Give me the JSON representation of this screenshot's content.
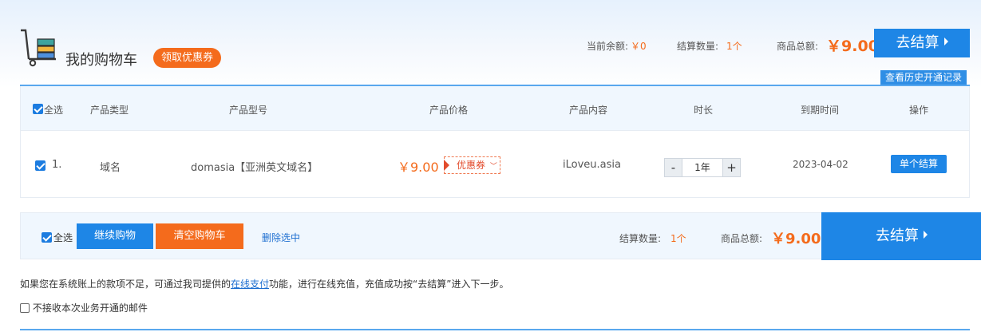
{
  "header": {
    "title": "我的购物车",
    "coupon_button": "领取优惠券",
    "balance_label": "当前余额:",
    "balance_value": "￥0",
    "count_label": "结算数量:",
    "count_value": "1个",
    "total_label": "商品总额:",
    "total_value": "￥9.00",
    "checkout_button": "去结算",
    "history_button": "查看历史开通记录"
  },
  "table": {
    "select_all": "全选",
    "columns": [
      "产品类型",
      "产品型号",
      "产品价格",
      "产品内容",
      "时长",
      "到期时间",
      "操作"
    ],
    "rows": [
      {
        "index": "1.",
        "type": "域名",
        "model": "domasia【亚洲英文域名】",
        "price": "￥9.00",
        "coupon": "优惠券",
        "content": "iLoveu.asia",
        "duration": "1年",
        "expiry": "2023-04-02",
        "action": "单个结算",
        "checked": true
      }
    ]
  },
  "bottom_bar": {
    "select_all": "全选",
    "continue_button": "继续购物",
    "clear_button": "清空购物车",
    "delete_link": "删除选中",
    "count_label": "结算数量:",
    "count_value": "1个",
    "total_label": "商品总额:",
    "total_value": "￥9.00",
    "checkout_button": "去结算"
  },
  "note": {
    "text_before": "如果您在系统账上的款项不足，可通过我司提供的",
    "link": "在线支付",
    "text_after": "功能，进行在线充值，充值成功按“去结算”进入下一步。"
  },
  "email_option": {
    "label": "不接收本次业务开通的邮件",
    "checked": false
  },
  "colors": {
    "accent_blue": "#1e86e6",
    "accent_orange": "#f46b1c"
  }
}
